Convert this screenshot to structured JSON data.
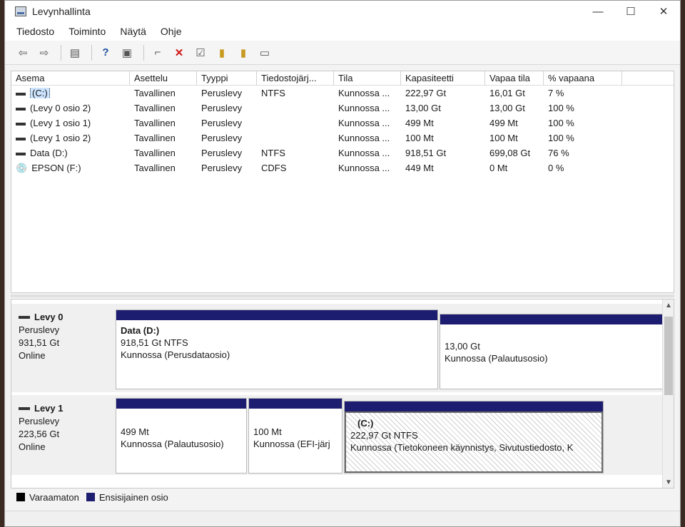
{
  "window": {
    "title": "Levynhallinta",
    "controls": [
      "—",
      "☐",
      "✕"
    ]
  },
  "menu": [
    "Tiedosto",
    "Toiminto",
    "Näytä",
    "Ohje"
  ],
  "toolbar": [
    "back-icon",
    "forward-icon",
    "properties-icon",
    "help-icon",
    "console-icon",
    "connect-icon",
    "delete-icon",
    "check-icon",
    "folder-up-icon",
    "folder-search-icon",
    "window-icon"
  ],
  "volumes": {
    "headers": [
      "Asema",
      "Asettelu",
      "Tyyppi",
      "Tiedostojärj...",
      "Tila",
      "Kapasiteetti",
      "Vapaa tila",
      "% vapaana"
    ],
    "rows": [
      [
        "(C:)",
        "Tavallinen",
        "Peruslevy",
        "NTFS",
        "Kunnossa ...",
        "222,97 Gt",
        "16,01 Gt",
        "7 %"
      ],
      [
        "(Levy 0 osio 2)",
        "Tavallinen",
        "Peruslevy",
        "",
        "Kunnossa ...",
        "13,00 Gt",
        "13,00 Gt",
        "100 %"
      ],
      [
        "(Levy 1 osio 1)",
        "Tavallinen",
        "Peruslevy",
        "",
        "Kunnossa ...",
        "499 Mt",
        "499 Mt",
        "100 %"
      ],
      [
        "(Levy 1 osio 2)",
        "Tavallinen",
        "Peruslevy",
        "",
        "Kunnossa ...",
        "100 Mt",
        "100 Mt",
        "100 %"
      ],
      [
        "Data (D:)",
        "Tavallinen",
        "Peruslevy",
        "NTFS",
        "Kunnossa ...",
        "918,51 Gt",
        "699,08 Gt",
        "76 %"
      ],
      [
        "EPSON (F:)",
        "Tavallinen",
        "Peruslevy",
        "CDFS",
        "Kunnossa ...",
        "449 Mt",
        "0 Mt",
        "0 %"
      ]
    ]
  },
  "disks": [
    {
      "name": "Levy 0",
      "type": "Peruslevy",
      "size": "931,51 Gt",
      "status": "Online",
      "partitions": [
        {
          "name": "Data  (D:)",
          "size": "918,51 Gt NTFS",
          "status": "Kunnossa (Perusdataosio)"
        },
        {
          "name": "",
          "size": "13,00 Gt",
          "status": "Kunnossa (Palautusosio)"
        }
      ]
    },
    {
      "name": "Levy 1",
      "type": "Peruslevy",
      "size": "223,56 Gt",
      "status": "Online",
      "partitions": [
        {
          "name": "",
          "size": "499 Mt",
          "status": "Kunnossa (Palautusosio)"
        },
        {
          "name": "",
          "size": "100 Mt",
          "status": "Kunnossa (EFI-järj"
        },
        {
          "name": "(C:)",
          "size": "222,97 Gt NTFS",
          "status": "Kunnossa (Tietokoneen käynnistys, Sivutustiedosto, K"
        }
      ]
    }
  ],
  "legend": [
    {
      "label": "Varaamaton",
      "color": "#000000"
    },
    {
      "label": "Ensisijainen osio",
      "color": "#1c1c70"
    }
  ]
}
